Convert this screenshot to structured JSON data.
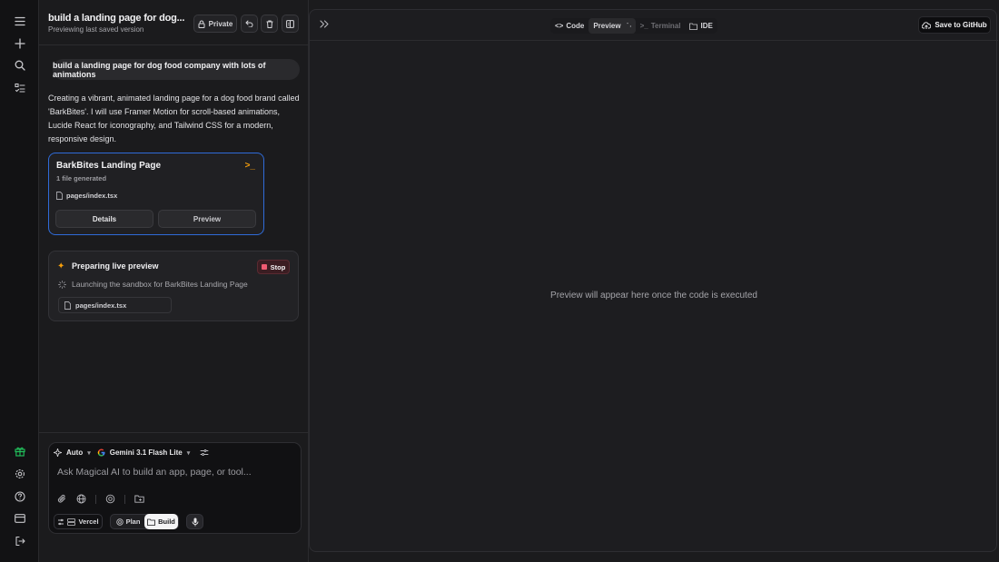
{
  "header": {
    "title": "build a landing page for dog...",
    "subtitle": "Previewing last saved version",
    "private_label": "Private"
  },
  "chat": {
    "user_message": "build a landing page for dog food company with lots of animations",
    "assistant_message": "Creating a vibrant, animated landing page for a dog food brand called 'BarkBites'. I will use Framer Motion for scroll-based animations, Lucide React for iconography, and Tailwind CSS for a modern, responsive design.",
    "artifact": {
      "title": "BarkBites Landing Page",
      "meta": "1 file generated",
      "file": "pages/index.tsx",
      "details_label": "Details",
      "preview_label": "Preview"
    },
    "preview_status": {
      "title": "Preparing live preview",
      "stop_label": "Stop",
      "status": "Launching the sandbox for BarkBites Landing Page",
      "file": "pages/index.tsx"
    }
  },
  "composer": {
    "mode": "Auto",
    "model": "Gemini 3.1 Flash Lite",
    "placeholder": "Ask Magical AI to build an app, page, or tool...",
    "vercel_label": "Vercel",
    "plan_label": "Plan",
    "build_label": "Build"
  },
  "workspace": {
    "tabs": [
      "Code",
      "Preview",
      "Terminal",
      "IDE"
    ],
    "github_label": "Save to GitHub",
    "placeholder": "Preview will appear here once the code is executed"
  },
  "colors": {
    "accent_blue": "#2f6bd8",
    "accent_orange": "#f59e0b",
    "gift_green": "#22c55e",
    "stop_red": "#f05b72"
  }
}
